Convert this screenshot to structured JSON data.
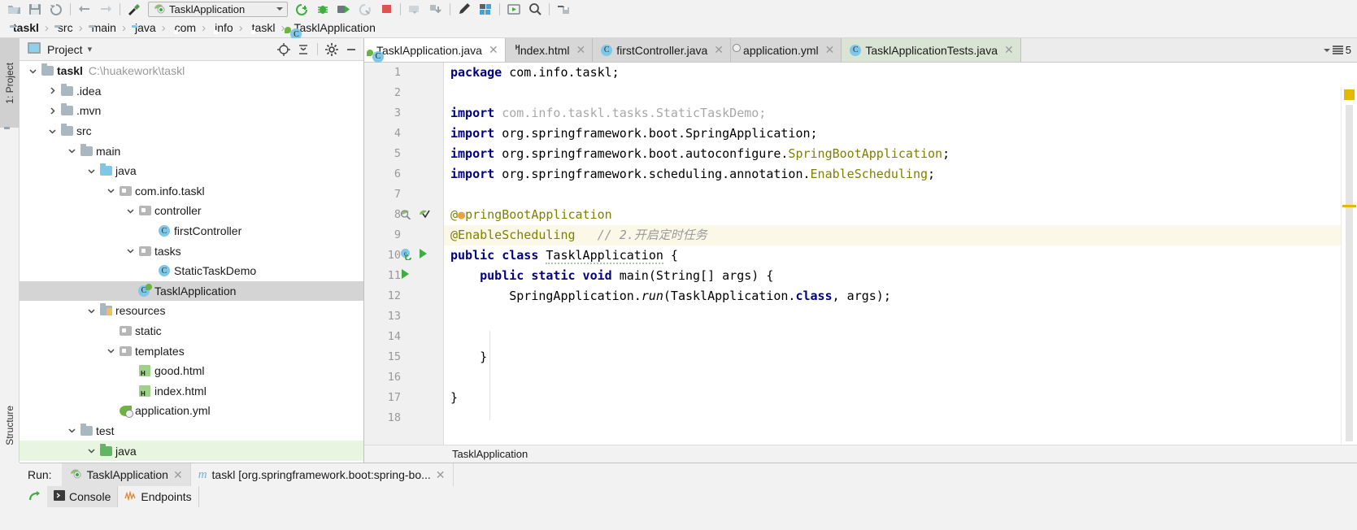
{
  "toolbar": {
    "icons": [
      "open-folder-icon",
      "save-icon",
      "sync-icon",
      "undo-icon",
      "redo-icon",
      "build-hammer-icon"
    ],
    "run_config": {
      "name": "TasklApplication",
      "icon": "spring-boot-run-config-icon"
    },
    "right_icons": [
      "run-with-coverage-icon",
      "debug-icon",
      "run-icon",
      "profile-icon",
      "stop-icon",
      "update-app-icon",
      "deploy-icon",
      "install-icon",
      "edit-icon",
      "plugins-icon",
      "run-anything-icon",
      "search-everywhere-icon",
      "save-all-icon"
    ]
  },
  "navbar": {
    "crumbs": [
      {
        "label": "taskl",
        "icon": "module-icon",
        "bold": true
      },
      {
        "label": "src",
        "icon": "folder-icon",
        "bold": false
      },
      {
        "label": "main",
        "icon": "folder-icon",
        "bold": false
      },
      {
        "label": "java",
        "icon": "source-folder-icon",
        "bold": false
      },
      {
        "label": "com",
        "icon": "package-icon",
        "bold": false
      },
      {
        "label": "info",
        "icon": "package-icon",
        "bold": false
      },
      {
        "label": "taskl",
        "icon": "package-icon",
        "bold": false
      },
      {
        "label": "TasklApplication",
        "icon": "spring-class-icon",
        "bold": false
      }
    ],
    "separator": "›"
  },
  "left_strip": {
    "project_tab": "1: Project",
    "structure_tab": "Structure"
  },
  "project_panel": {
    "title": "Project",
    "dropdown_caret": "▾",
    "actions": [
      "locate-icon",
      "collapse-all-icon",
      "settings-gear-icon",
      "hide-icon"
    ],
    "tree": [
      {
        "depth": 0,
        "arrow": "down",
        "icon": "module-icon",
        "label": "taskl",
        "bold": true,
        "path": "C:\\huakework\\taskl",
        "state": "normal"
      },
      {
        "depth": 1,
        "arrow": "right",
        "icon": "folder-icon",
        "label": ".idea",
        "bold": false,
        "path": "",
        "state": "normal"
      },
      {
        "depth": 1,
        "arrow": "right",
        "icon": "folder-icon",
        "label": ".mvn",
        "bold": false,
        "path": "",
        "state": "normal"
      },
      {
        "depth": 1,
        "arrow": "down",
        "icon": "folder-icon",
        "label": "src",
        "bold": false,
        "path": "",
        "state": "normal"
      },
      {
        "depth": 2,
        "arrow": "down",
        "icon": "folder-icon",
        "label": "main",
        "bold": false,
        "path": "",
        "state": "normal"
      },
      {
        "depth": 3,
        "arrow": "down",
        "icon": "source-folder-icon",
        "label": "java",
        "bold": false,
        "path": "",
        "state": "normal"
      },
      {
        "depth": 4,
        "arrow": "down",
        "icon": "package-icon",
        "label": "com.info.taskl",
        "bold": false,
        "path": "",
        "state": "normal"
      },
      {
        "depth": 5,
        "arrow": "down",
        "icon": "package-icon",
        "label": "controller",
        "bold": false,
        "path": "",
        "state": "normal"
      },
      {
        "depth": 6,
        "arrow": "none",
        "icon": "java-class-icon",
        "label": "firstController",
        "bold": false,
        "path": "",
        "state": "normal"
      },
      {
        "depth": 5,
        "arrow": "down",
        "icon": "package-icon",
        "label": "tasks",
        "bold": false,
        "path": "",
        "state": "normal"
      },
      {
        "depth": 6,
        "arrow": "none",
        "icon": "java-class-icon",
        "label": "StaticTaskDemo",
        "bold": false,
        "path": "",
        "state": "normal"
      },
      {
        "depth": 5,
        "arrow": "none",
        "icon": "spring-class-icon",
        "label": "TasklApplication",
        "bold": false,
        "path": "",
        "state": "selected"
      },
      {
        "depth": 3,
        "arrow": "down",
        "icon": "resource-folder-icon",
        "label": "resources",
        "bold": false,
        "path": "",
        "state": "normal"
      },
      {
        "depth": 4,
        "arrow": "none",
        "icon": "package-icon",
        "label": "static",
        "bold": false,
        "path": "",
        "state": "normal"
      },
      {
        "depth": 4,
        "arrow": "down",
        "icon": "package-icon",
        "label": "templates",
        "bold": false,
        "path": "",
        "state": "normal"
      },
      {
        "depth": 5,
        "arrow": "none",
        "icon": "html-file-icon",
        "label": "good.html",
        "bold": false,
        "path": "",
        "state": "normal"
      },
      {
        "depth": 5,
        "arrow": "none",
        "icon": "html-file-icon",
        "label": "index.html",
        "bold": false,
        "path": "",
        "state": "normal"
      },
      {
        "depth": 4,
        "arrow": "none",
        "icon": "spring-yaml-icon",
        "label": "application.yml",
        "bold": false,
        "path": "",
        "state": "normal"
      },
      {
        "depth": 2,
        "arrow": "down",
        "icon": "folder-icon",
        "label": "test",
        "bold": false,
        "path": "",
        "state": "normal"
      },
      {
        "depth": 3,
        "arrow": "down",
        "icon": "test-source-folder-icon",
        "label": "java",
        "bold": false,
        "path": "",
        "state": "greenish"
      }
    ]
  },
  "editor": {
    "tabs": [
      {
        "label": "TasklApplication.java",
        "icon": "spring-class-icon",
        "active": true,
        "style": "white"
      },
      {
        "label": "index.html",
        "icon": "html-file-icon",
        "active": false,
        "style": "gray"
      },
      {
        "label": "firstController.java",
        "icon": "java-class-icon",
        "active": false,
        "style": "gray"
      },
      {
        "label": "application.yml",
        "icon": "spring-yaml-icon",
        "active": false,
        "style": "gray"
      },
      {
        "label": "TasklApplicationTests.java",
        "icon": "test-class-icon",
        "active": false,
        "style": "green"
      }
    ],
    "tab_overflow_count": "5",
    "breadcrumb": "TasklApplication",
    "inspection_status_color": "#e6b800",
    "lines": [
      {
        "n": "1",
        "highlight": false,
        "fold": "none",
        "gutter": [],
        "tokens": [
          {
            "t": "package",
            "c": "kw"
          },
          {
            "t": " com.info.taskl;",
            "c": "plain"
          }
        ]
      },
      {
        "n": "2",
        "highlight": false,
        "fold": "none",
        "gutter": [],
        "tokens": []
      },
      {
        "n": "3",
        "highlight": false,
        "fold": "start",
        "gutter": [],
        "tokens": [
          {
            "t": "import",
            "c": "kw"
          },
          {
            "t": " com.info.taskl.tasks.StaticTaskDemo;",
            "c": "grayed"
          }
        ]
      },
      {
        "n": "4",
        "highlight": false,
        "fold": "none",
        "gutter": [],
        "tokens": [
          {
            "t": "import",
            "c": "kw"
          },
          {
            "t": " org.springframework.boot.SpringApplication;",
            "c": "plain"
          }
        ]
      },
      {
        "n": "5",
        "highlight": false,
        "fold": "none",
        "gutter": [],
        "tokens": [
          {
            "t": "import",
            "c": "kw"
          },
          {
            "t": " org.springframework.boot.autoconfigure.",
            "c": "plain"
          },
          {
            "t": "SpringBootApplication",
            "c": "ann"
          },
          {
            "t": ";",
            "c": "plain"
          }
        ]
      },
      {
        "n": "6",
        "highlight": false,
        "fold": "end",
        "gutter": [],
        "tokens": [
          {
            "t": "import",
            "c": "kw"
          },
          {
            "t": " org.springframework.scheduling.annotation.",
            "c": "plain"
          },
          {
            "t": "EnableScheduling",
            "c": "ann"
          },
          {
            "t": ";",
            "c": "plain"
          }
        ]
      },
      {
        "n": "7",
        "highlight": false,
        "fold": "none",
        "gutter": [],
        "tokens": []
      },
      {
        "n": "8",
        "highlight": false,
        "fold": "start",
        "gutter": [
          "spring-bean-icon",
          "spring-config-check-icon"
        ],
        "tokens": [
          {
            "t": "@",
            "c": "ann"
          },
          {
            "t": "●",
            "c": "bulb"
          },
          {
            "t": "pringBootApplication",
            "c": "ann"
          }
        ]
      },
      {
        "n": "9",
        "highlight": true,
        "fold": "mid",
        "gutter": [],
        "tokens": [
          {
            "t": "@EnableScheduling",
            "c": "ann"
          },
          {
            "t": "   ",
            "c": "plain"
          },
          {
            "t": "// 2.开启定时任务",
            "c": "cmt"
          }
        ]
      },
      {
        "n": "10",
        "highlight": false,
        "fold": "none",
        "gutter": [
          "spring-class-gutter-icon",
          "run-gutter-icon"
        ],
        "tokens": [
          {
            "t": "public class",
            "c": "kw"
          },
          {
            "t": " ",
            "c": "plain"
          },
          {
            "t": "TasklApplication",
            "c": "squig"
          },
          {
            "t": " {",
            "c": "plain"
          }
        ]
      },
      {
        "n": "11",
        "highlight": false,
        "fold": "start",
        "gutter": [
          "run-gutter-icon"
        ],
        "tokens": [
          {
            "t": "    ",
            "c": "plain"
          },
          {
            "t": "public static void",
            "c": "kw"
          },
          {
            "t": " main(String[] args) {",
            "c": "plain"
          }
        ]
      },
      {
        "n": "12",
        "highlight": false,
        "fold": "none",
        "gutter": [],
        "tokens": [
          {
            "t": "        SpringApplication.",
            "c": "plain"
          },
          {
            "t": "run",
            "c": "italic"
          },
          {
            "t": "(TasklApplication.",
            "c": "plain"
          },
          {
            "t": "class",
            "c": "kw"
          },
          {
            "t": ", args);",
            "c": "plain"
          }
        ]
      },
      {
        "n": "13",
        "highlight": false,
        "fold": "none",
        "gutter": [],
        "tokens": []
      },
      {
        "n": "14",
        "highlight": false,
        "fold": "none",
        "gutter": [],
        "tokens": []
      },
      {
        "n": "15",
        "highlight": false,
        "fold": "end",
        "gutter": [],
        "tokens": [
          {
            "t": "    }",
            "c": "plain"
          }
        ]
      },
      {
        "n": "16",
        "highlight": false,
        "fold": "none",
        "gutter": [],
        "tokens": []
      },
      {
        "n": "17",
        "highlight": false,
        "fold": "none",
        "gutter": [],
        "tokens": [
          {
            "t": "}",
            "c": "plain"
          }
        ]
      },
      {
        "n": "18",
        "highlight": false,
        "fold": "none",
        "gutter": [],
        "tokens": []
      }
    ]
  },
  "run_panel": {
    "label": "Run:",
    "tabs": [
      {
        "label": "TasklApplication",
        "icon": "spring-boot-run-icon",
        "active": true
      },
      {
        "label": "taskl [org.springframework.boot:spring-bo...",
        "icon": "maven-icon",
        "active": false
      }
    ],
    "bottom_tabs": [
      {
        "label": "Console",
        "icon": "console-icon",
        "active": true
      },
      {
        "label": "Endpoints",
        "icon": "endpoints-icon",
        "active": false
      }
    ],
    "rerun_icon": "rerun-icon"
  }
}
